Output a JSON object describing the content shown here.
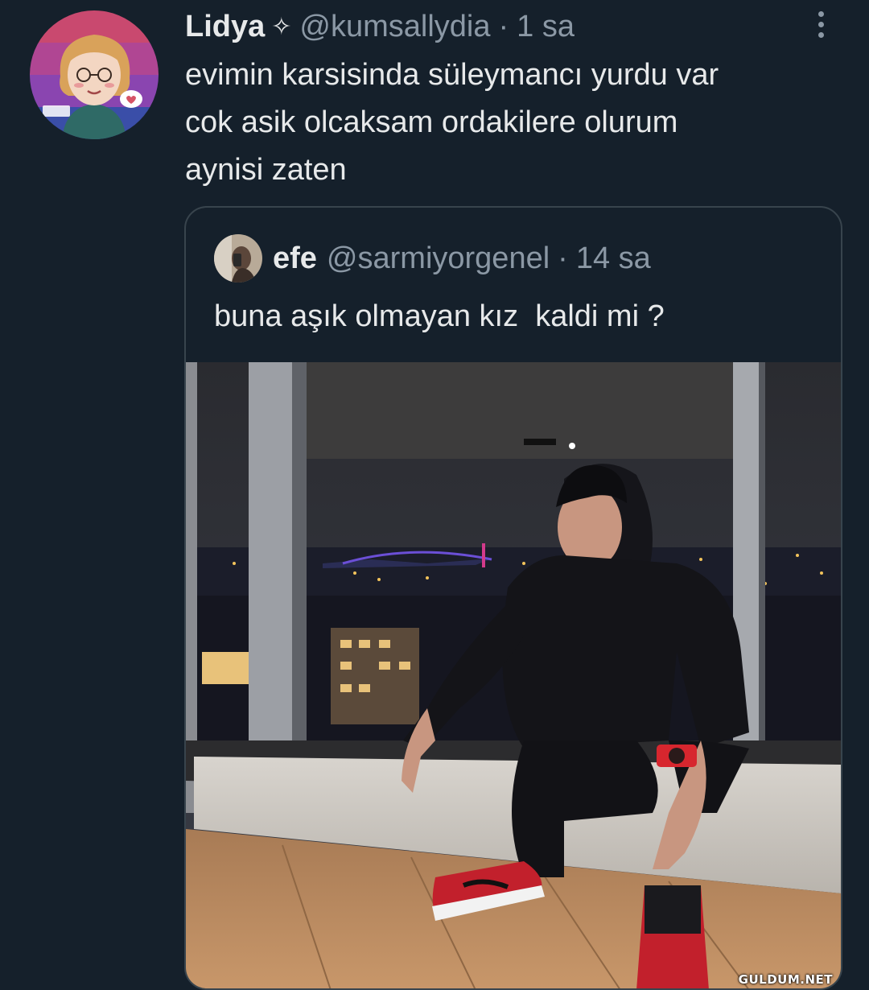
{
  "tweet": {
    "author_name": "Lidya",
    "badge": "✧",
    "handle": "@kumsallydia",
    "separator": "·",
    "time": "1 sa",
    "text_lines": [
      "evimin karsisinda süleymancı yurdu var",
      "cok asik olcaksam ordakilere olurum",
      "aynisi zaten"
    ],
    "avatar_icon": "cartoon-portrait-icon",
    "more_icon": "more-vertical-icon"
  },
  "quoted": {
    "author_name": "efe",
    "handle": "@sarmiyorgenel",
    "separator": "·",
    "time": "14 sa",
    "text": "buna aşık olmayan kız  kaldi mi ?",
    "avatar_icon": "profile-photo-icon"
  },
  "watermark": "GULDUM.NET",
  "colors": {
    "background": "#15202b",
    "text_primary": "#e7e9ea",
    "text_secondary": "#8b98a5",
    "border": "#38444d"
  }
}
